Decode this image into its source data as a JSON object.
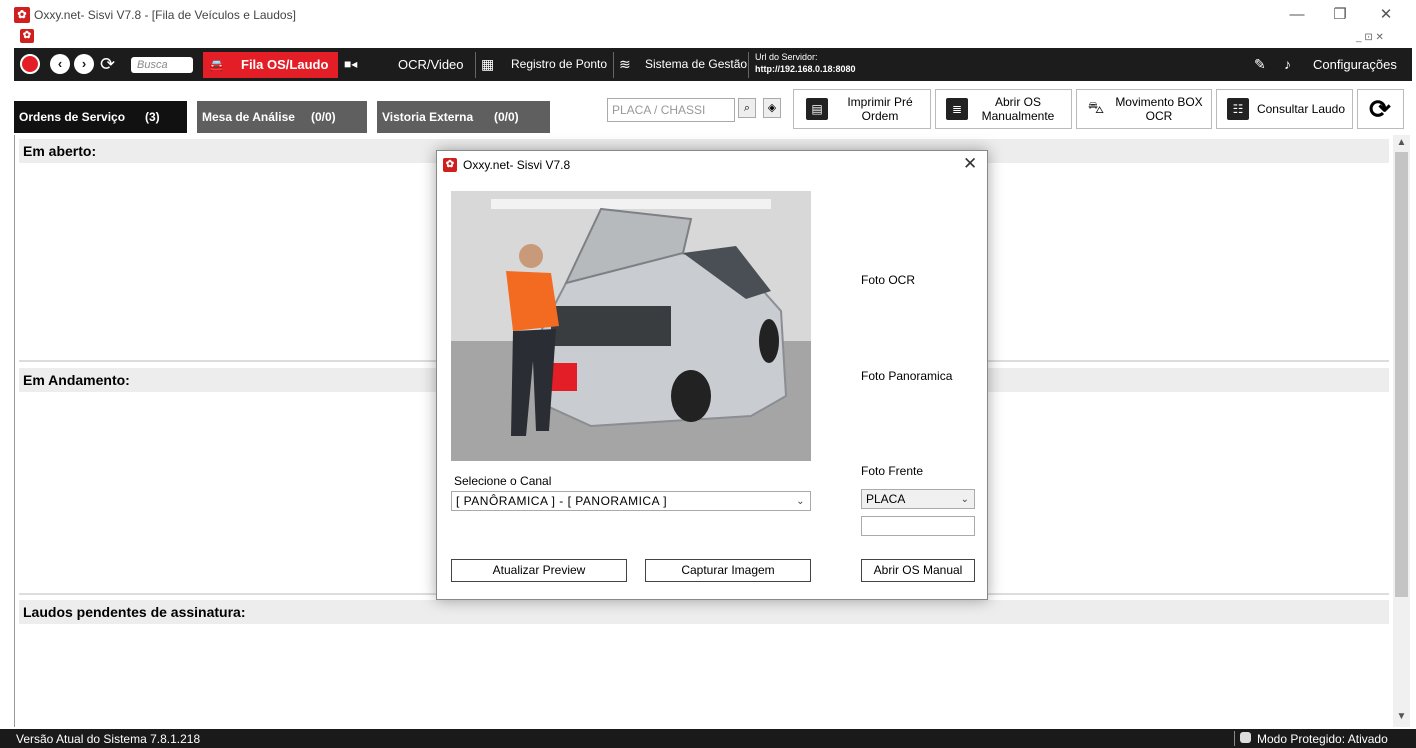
{
  "window": {
    "title": "Oxxy.net- Sisvi V7.8 - [Fila de Veículos e Laudos]",
    "logo_glyph": "✿",
    "minimize_glyph": "—",
    "restore_glyph": "❐",
    "close_glyph": "✕",
    "mdi_controls": "_ ⊡ ✕"
  },
  "toolbar": {
    "search_placeholder": "Busca",
    "fila_label": "Fila OS/Laudo",
    "ocr_label": "OCR/Video",
    "registro_label": "Registro de Ponto",
    "gestao_label": "Sistema de Gestão",
    "url_title": "Url do Servidor:",
    "url_value": "http://192.168.0.18:8080",
    "config_label": "Configurações"
  },
  "tabs": [
    {
      "label": "Ordens de Serviço",
      "count": "(3)"
    },
    {
      "label": "Mesa de Análise",
      "count": "(0/0)"
    },
    {
      "label": "Vistoria Externa",
      "count": "(0/0)"
    }
  ],
  "placa_placeholder": "PLACA / CHASSI",
  "actions": {
    "imprimir_l1": "Imprimir Pré",
    "imprimir_l2": "Ordem",
    "abrir_l1": "Abrir OS",
    "abrir_l2": "Manualmente",
    "movimento_l1": "Movimento BOX",
    "movimento_l2": "OCR",
    "consultar": "Consultar Laudo"
  },
  "sections": {
    "aberto": "Em aberto:",
    "andamento": "Em Andamento:",
    "laudos": "Laudos pendentes de assinatura:"
  },
  "status": {
    "version": "Versão Atual do Sistema 7.8.1.218",
    "mode": "Modo Protegido: Ativado"
  },
  "dialog": {
    "title": "Oxxy.net- Sisvi V7.8",
    "foto_ocr": "Foto OCR",
    "foto_panoramica": "Foto Panoramica",
    "foto_frente": "Foto Frente",
    "canal_label": "Selecione o Canal",
    "canal_value": "[ PANÔRAMICA ] - [ PANORAMICA ]",
    "placa_value": "PLACA",
    "btn_atualizar": "Atualizar Preview",
    "btn_capturar": "Capturar Imagem",
    "btn_abrir": "Abrir OS Manual"
  },
  "colors": {
    "accent_red": "#e41e26",
    "toolbar_dark": "#1c1c1c",
    "tab_active": "#111111",
    "tab_inactive": "#5f5f5f"
  }
}
